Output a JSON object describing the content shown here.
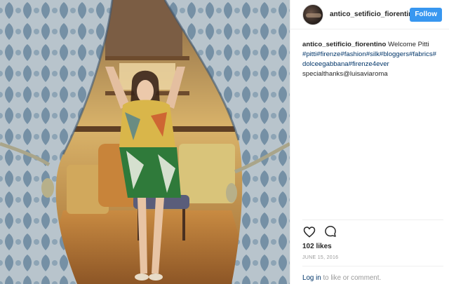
{
  "post": {
    "photo_icon": "post-photo",
    "header": {
      "avatar_icon": "avatar",
      "username": "antico_setificio_fiorentin",
      "follow_label": "Follow"
    },
    "caption": {
      "username": "antico_setificio_fiorentino",
      "text": "Welcome Pitti",
      "tags_line1": [
        "#pitti",
        "#firenze",
        "#fashion",
        "#silk",
        "#bloggers",
        "#fabrics",
        "#"
      ],
      "tags_line2": [
        "dolceegabbana",
        "#firenze4ever"
      ],
      "line3_text": "specialthanks",
      "line3_mention": "@luisaviaroma"
    },
    "actions": {
      "like_icon": "heart-icon",
      "comment_icon": "comment-icon"
    },
    "likes": "102 likes",
    "date": "JUNE 15, 2016",
    "comment_prompt": {
      "login_label": "Log in",
      "rest": "to like or comment."
    }
  },
  "colors": {
    "follow_button": "#3897f0",
    "link": "#003569",
    "muted": "#999999"
  }
}
